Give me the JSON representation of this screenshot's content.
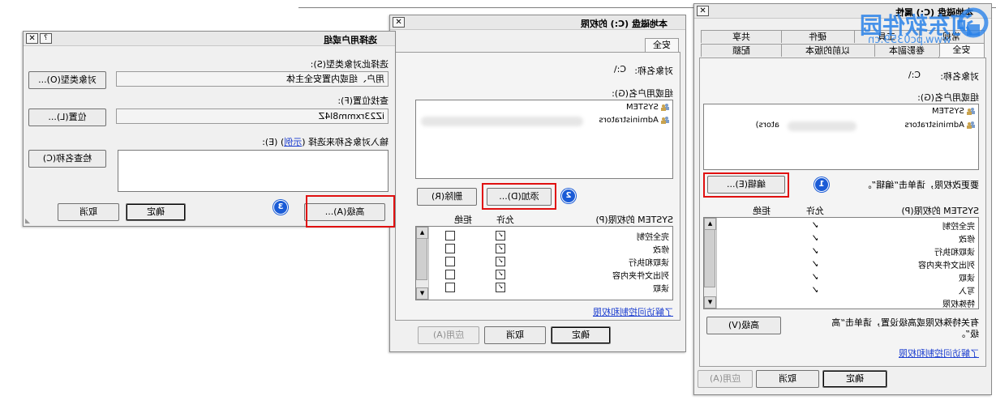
{
  "colors": {
    "highlight_box": "#e01010",
    "step_badge": "#1a5bd6",
    "link": "#1a3ccf",
    "watermark": "#2a82e8"
  },
  "watermark": {
    "brand": "河东软件园",
    "url": "www.pc0359.cn"
  },
  "select_dialog": {
    "title": "选择用户或组",
    "help_glyph": "?",
    "close_glyph": "✕",
    "object_type_label": "选择此对象类型(S):",
    "object_type_value": "用户、组或内置安全主体",
    "object_type_button": "对象类型(O)...",
    "location_label": "查找位置(F):",
    "location_value": "iZ23rxmm8l4Z",
    "location_button": "位置(L)...",
    "enter_names_label": "输入对象名称来选择",
    "examples_link": "示例",
    "enter_names_suffix": "(E):",
    "names_value": "",
    "check_names_button": "检查名称(C)",
    "advanced_button": "高级(A)...",
    "ok_button": "确定",
    "cancel_button": "取消",
    "step_number": "3"
  },
  "perm_dialog": {
    "title": "本地磁盘 (C:) 的权限",
    "close_glyph": "✕",
    "tab_security": "安全",
    "object_name_label": "对象名称:",
    "object_name_value": "C:\\",
    "group_label": "组或用户名(G):",
    "users": [
      "SYSTEM",
      "Administrators"
    ],
    "add_button": "添加(D)...",
    "remove_button": "删除(R)",
    "step_number": "2",
    "perm_header": "SYSTEM 的权限(P)",
    "allow_header": "允许",
    "deny_header": "拒绝",
    "permissions": [
      {
        "name": "完全控制",
        "allow": true,
        "deny": false
      },
      {
        "name": "修改",
        "allow": true,
        "deny": false
      },
      {
        "name": "读取和执行",
        "allow": true,
        "deny": false
      },
      {
        "name": "列出文件夹内容",
        "allow": true,
        "deny": false
      },
      {
        "name": "读取",
        "allow": true,
        "deny": false
      }
    ],
    "learn_link": "了解访问控制和权限",
    "ok_button": "确定",
    "cancel_button": "取消",
    "apply_button": "应用(A)"
  },
  "props_dialog": {
    "title": "本地磁盘 (C:) 属性",
    "close_glyph": "✕",
    "tabs_row1": [
      "常规",
      "工具",
      "硬件",
      "共享"
    ],
    "tabs_row2": [
      "安全",
      "卷影副本",
      "以前的版本",
      "配额"
    ],
    "object_name_label": "对象名称:",
    "object_name_value": "C:\\",
    "group_label": "组或用户名(G):",
    "users": [
      "SYSTEM",
      "Administrators"
    ],
    "users_suffix": "ators)",
    "edit_hint": "要更改权限，请单击“编辑”。",
    "edit_button": "编辑(E)...",
    "step_number": "1",
    "perm_header": "SYSTEM 的权限(P)",
    "allow_header": "允许",
    "deny_header": "拒绝",
    "permissions": [
      {
        "name": "完全控制",
        "allow": true
      },
      {
        "name": "修改",
        "allow": true
      },
      {
        "name": "读取和执行",
        "allow": true
      },
      {
        "name": "列出文件夹内容",
        "allow": true
      },
      {
        "name": "读取",
        "allow": true
      },
      {
        "name": "写入",
        "allow": true
      },
      {
        "name": "特殊权限",
        "allow": false
      }
    ],
    "advanced_hint_line1": "有关特殊权限或高级设置，请单击“高",
    "advanced_hint_line2": "级”。",
    "advanced_button": "高级(V)",
    "learn_link": "了解访问控制和权限",
    "ok_button": "确定",
    "cancel_button": "取消",
    "apply_button": "应用(A)"
  }
}
